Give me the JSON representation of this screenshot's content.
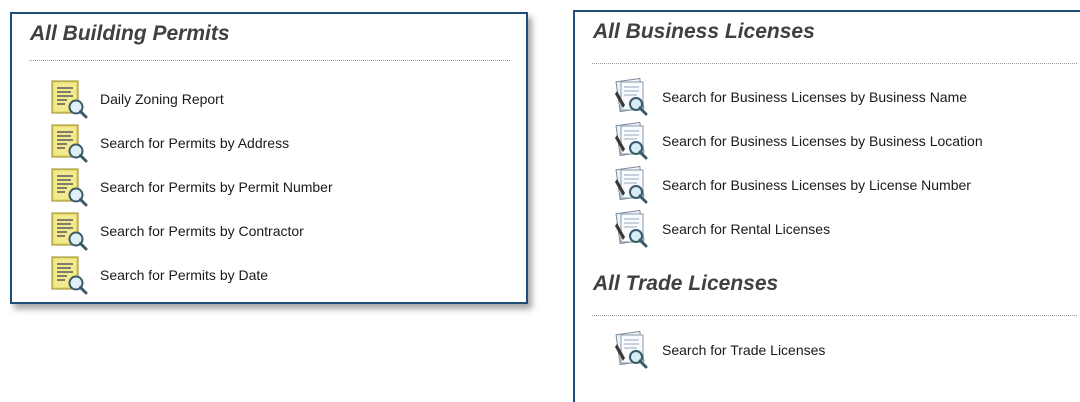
{
  "building": {
    "title": "All Building Permits",
    "items": [
      {
        "label": "Daily Zoning Report",
        "icon": "zoning-report-icon"
      },
      {
        "label": "Search for Permits by Address",
        "icon": "permit-search-icon"
      },
      {
        "label": "Search for Permits by Permit Number",
        "icon": "permit-search-icon"
      },
      {
        "label": "Search for Permits by Contractor",
        "icon": "permit-search-icon"
      },
      {
        "label": "Search for Permits by Date",
        "icon": "permit-search-icon"
      }
    ]
  },
  "business": {
    "title": "All Business Licenses",
    "items": [
      {
        "label": "Search for Business Licenses by Business Name",
        "icon": "license-search-icon"
      },
      {
        "label": "Search for Business Licenses by Business Location",
        "icon": "license-search-icon"
      },
      {
        "label": "Search for Business Licenses by License Number",
        "icon": "license-search-icon"
      },
      {
        "label": "Search for Rental Licenses",
        "icon": "license-search-icon"
      }
    ]
  },
  "trade": {
    "title": "All Trade Licenses",
    "items": [
      {
        "label": "Search for Trade Licenses",
        "icon": "license-search-icon"
      }
    ]
  },
  "colors": {
    "panel_border": "#1f4e79",
    "title_text": "#404040",
    "report_yellow": "#e8d96a"
  }
}
